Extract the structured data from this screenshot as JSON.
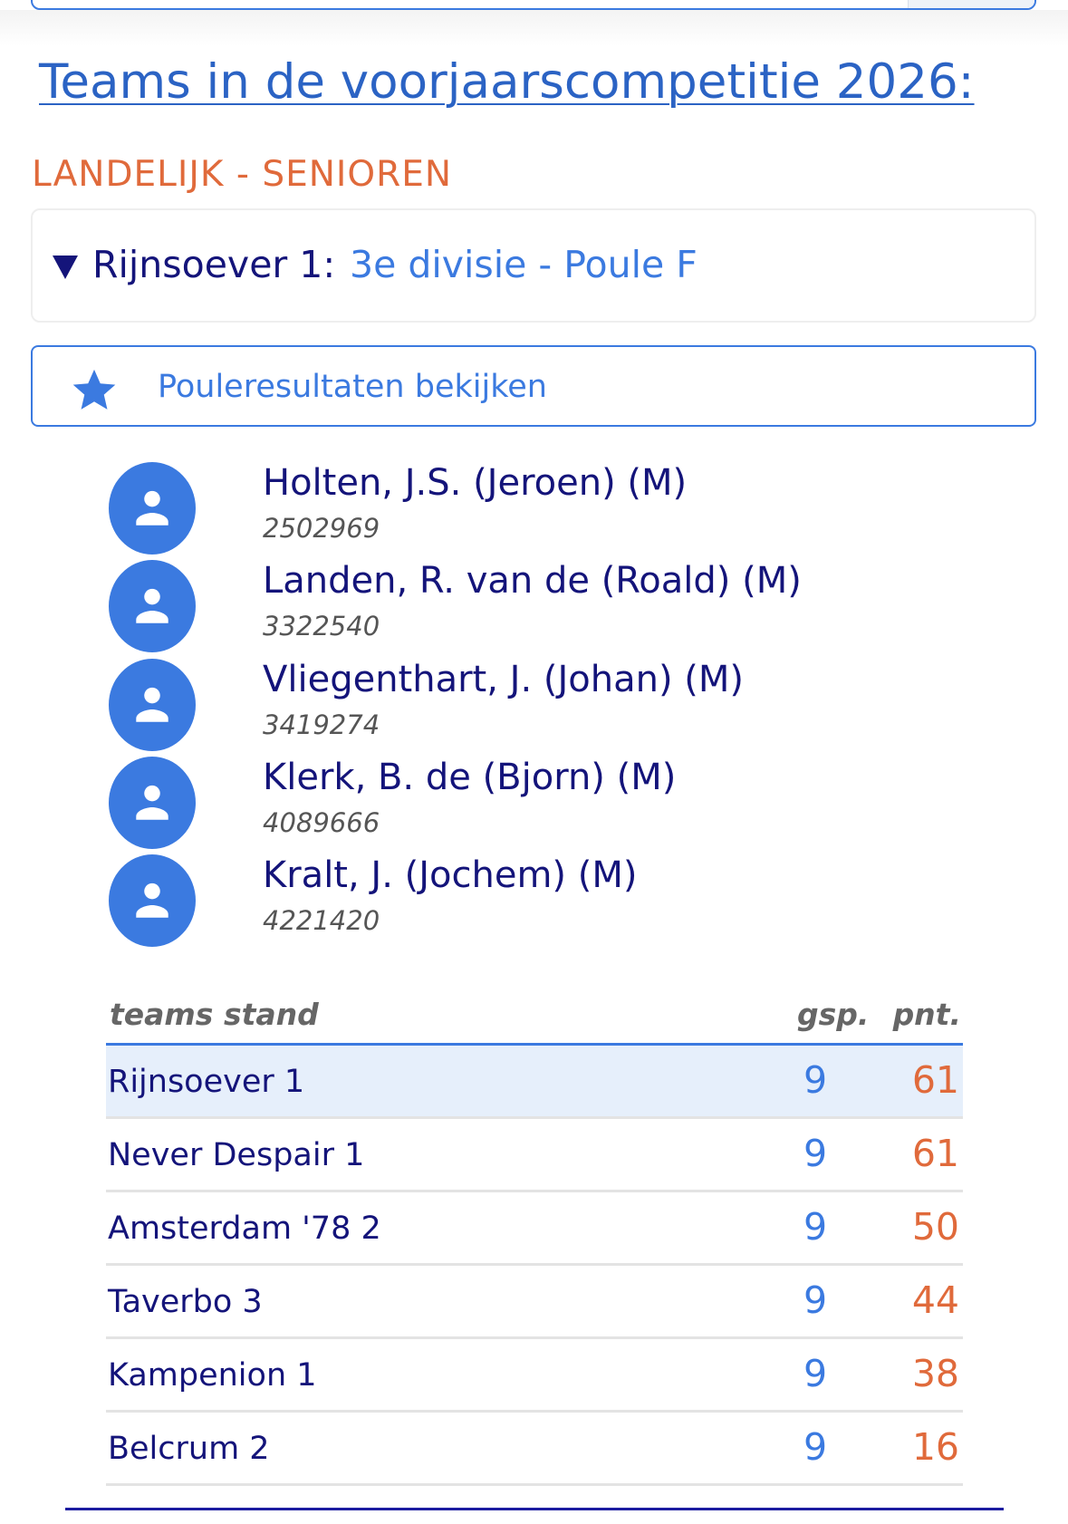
{
  "page_title": "Teams in de voorjaarscompetitie 2026:",
  "section_label": "LANDELIJK - SENIOREN",
  "team": {
    "name": "Rijnsoever 1:",
    "division": "3e divisie - Poule F"
  },
  "poule_button": {
    "label": "Pouleresultaten bekijken",
    "icon": "star-icon"
  },
  "players": [
    {
      "name": "Holten, J.S. (Jeroen) (M)",
      "number": "2502969"
    },
    {
      "name": "Landen, R. van de (Roald) (M)",
      "number": "3322540"
    },
    {
      "name": "Vliegenthart, J. (Johan) (M)",
      "number": "3419274"
    },
    {
      "name": "Klerk, B. de (Bjorn) (M)",
      "number": "4089666"
    },
    {
      "name": "Kralt, J. (Jochem) (M)",
      "number": "4221420"
    }
  ],
  "standings": {
    "headers": {
      "team": "teams stand",
      "played": "gsp.",
      "points": "pnt."
    },
    "rows": [
      {
        "team": "Rijnsoever 1",
        "played": "9",
        "points": "61",
        "highlight": true
      },
      {
        "team": "Never Despair 1",
        "played": "9",
        "points": "61"
      },
      {
        "team": "Amsterdam '78 2",
        "played": "9",
        "points": "50"
      },
      {
        "team": "Taverbo 3",
        "played": "9",
        "points": "44"
      },
      {
        "team": "Kampenion 1",
        "played": "9",
        "points": "38"
      },
      {
        "team": "Belcrum 2",
        "played": "9",
        "points": "16"
      }
    ]
  },
  "colors": {
    "accent": "#3b7ae0",
    "navy": "#14147a",
    "orange": "#e06a3b",
    "highlight_row": "#e6effb"
  }
}
